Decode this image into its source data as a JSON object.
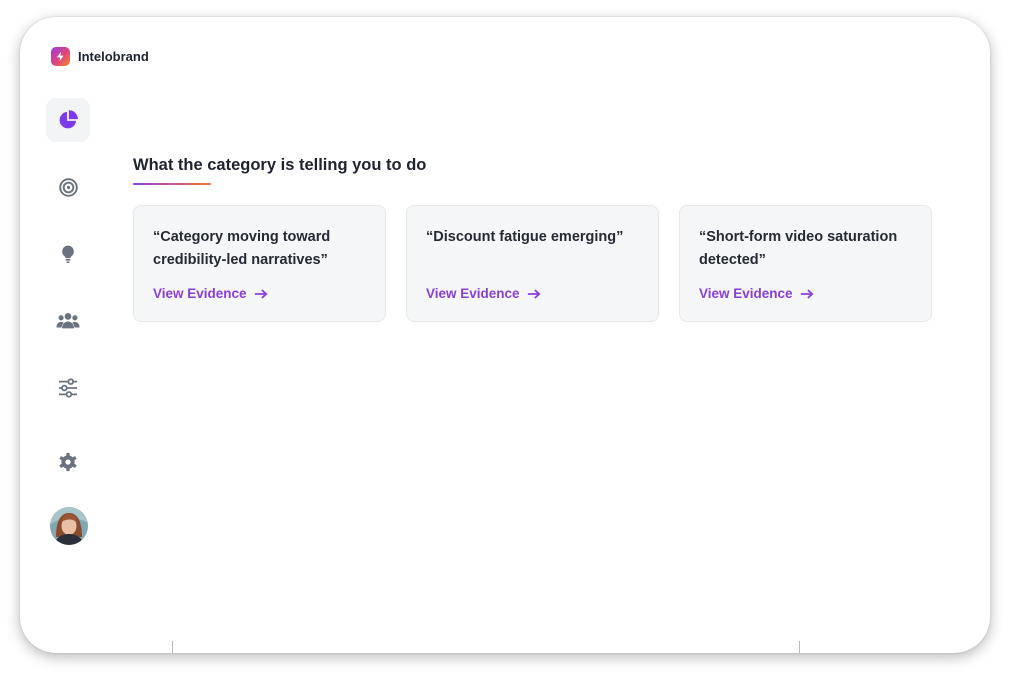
{
  "brand": {
    "name": "Intelobrand",
    "logo_icon": "lightning-bolt-icon"
  },
  "sidebar": {
    "items": [
      {
        "id": "insights",
        "icon": "pie-chart-icon",
        "active": true
      },
      {
        "id": "targets",
        "icon": "target-icon",
        "active": false
      },
      {
        "id": "ideas",
        "icon": "lightbulb-icon",
        "active": false
      },
      {
        "id": "audience",
        "icon": "users-icon",
        "active": false
      },
      {
        "id": "filters",
        "icon": "sliders-icon",
        "active": false
      },
      {
        "id": "settings",
        "icon": "gear-icon",
        "active": false
      }
    ],
    "avatar": "user-avatar"
  },
  "main": {
    "section_title": "What the category is telling you to do",
    "cards": [
      {
        "quote": "“Category moving toward credibility-led narratives”",
        "link_label": "View Evidence"
      },
      {
        "quote": "“Discount fatigue emerging”",
        "link_label": "View Evidence"
      },
      {
        "quote": "“Short-form video saturation detected”",
        "link_label": "View Evidence"
      }
    ]
  },
  "colors": {
    "accent": "#8a3fd8",
    "active_icon": "#7c3aed",
    "inactive_icon": "#6b7280",
    "card_bg": "#f5f6f8",
    "text": "#1f2330"
  }
}
